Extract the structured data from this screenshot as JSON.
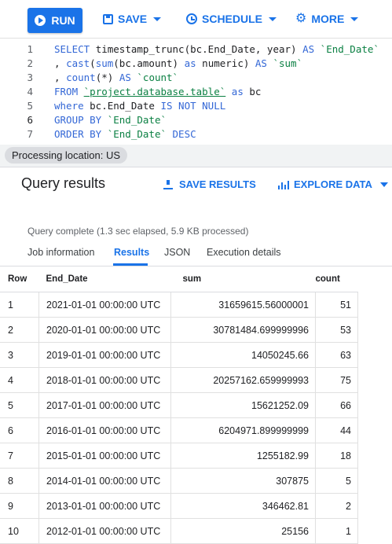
{
  "toolbar": {
    "run_label": "RUN",
    "save_label": "SAVE",
    "schedule_label": "SCHEDULE",
    "more_label": "MORE"
  },
  "editor": {
    "lines": [
      {
        "num": "1",
        "tokens": [
          [
            "kw",
            "SELECT "
          ],
          [
            "plain",
            "timestamp_trunc(bc.End_Date, year) "
          ],
          [
            "kw",
            "AS "
          ],
          [
            "str",
            "`End_Date`"
          ]
        ]
      },
      {
        "num": "2",
        "tokens": [
          [
            "plain",
            ", "
          ],
          [
            "kw",
            "cast"
          ],
          [
            "plain",
            "("
          ],
          [
            "kw",
            "sum"
          ],
          [
            "plain",
            "(bc.amount) "
          ],
          [
            "kw",
            "as "
          ],
          [
            "plain",
            "numeric) "
          ],
          [
            "kw",
            "AS "
          ],
          [
            "str",
            "`sum`"
          ]
        ]
      },
      {
        "num": "3",
        "tokens": [
          [
            "plain",
            ", "
          ],
          [
            "kw",
            "count"
          ],
          [
            "plain",
            "(*) "
          ],
          [
            "kw",
            "AS "
          ],
          [
            "str",
            "`count`"
          ]
        ]
      },
      {
        "num": "4",
        "tokens": [
          [
            "kw",
            "FROM "
          ],
          [
            "tbl",
            "`project.database.table`"
          ],
          [
            "kw",
            " as "
          ],
          [
            "plain",
            "bc"
          ]
        ]
      },
      {
        "num": "5",
        "tokens": [
          [
            "kw",
            "where "
          ],
          [
            "plain",
            "bc.End_Date "
          ],
          [
            "kw",
            "IS NOT NULL"
          ]
        ]
      },
      {
        "num": "6",
        "tokens": [
          [
            "kw",
            "GROUP BY "
          ],
          [
            "str",
            "`End_Date`"
          ]
        ]
      },
      {
        "num": "7",
        "tokens": [
          [
            "kw",
            "ORDER BY "
          ],
          [
            "str",
            "`End_Date`"
          ],
          [
            "kw",
            " DESC"
          ]
        ]
      }
    ]
  },
  "processing_location": "Processing location: US",
  "results": {
    "title": "Query results",
    "save_results_label": "SAVE RESULTS",
    "explore_data_label": "EXPLORE DATA",
    "status": "Query complete (1.3 sec elapsed, 5.9 KB processed)",
    "tabs": [
      "Job information",
      "Results",
      "JSON",
      "Execution details"
    ],
    "active_tab": "Results",
    "columns": [
      "Row",
      "End_Date",
      "sum",
      "count"
    ],
    "rows": [
      [
        "1",
        "2021-01-01 00:00:00 UTC",
        "31659615.56000001",
        "51"
      ],
      [
        "2",
        "2020-01-01 00:00:00 UTC",
        "30781484.699999996",
        "53"
      ],
      [
        "3",
        "2019-01-01 00:00:00 UTC",
        "14050245.66",
        "63"
      ],
      [
        "4",
        "2018-01-01 00:00:00 UTC",
        "20257162.659999993",
        "75"
      ],
      [
        "5",
        "2017-01-01 00:00:00 UTC",
        "15621252.09",
        "66"
      ],
      [
        "6",
        "2016-01-01 00:00:00 UTC",
        "6204971.899999999",
        "44"
      ],
      [
        "7",
        "2015-01-01 00:00:00 UTC",
        "1255182.99",
        "18"
      ],
      [
        "8",
        "2014-01-01 00:00:00 UTC",
        "307875",
        "5"
      ],
      [
        "9",
        "2013-01-01 00:00:00 UTC",
        "346462.81",
        "2"
      ],
      [
        "10",
        "2012-01-01 00:00:00 UTC",
        "25156",
        "1"
      ]
    ]
  },
  "colors": {
    "accent": "#1a73e8",
    "keyword": "#3367d6",
    "string": "#0b8043"
  }
}
